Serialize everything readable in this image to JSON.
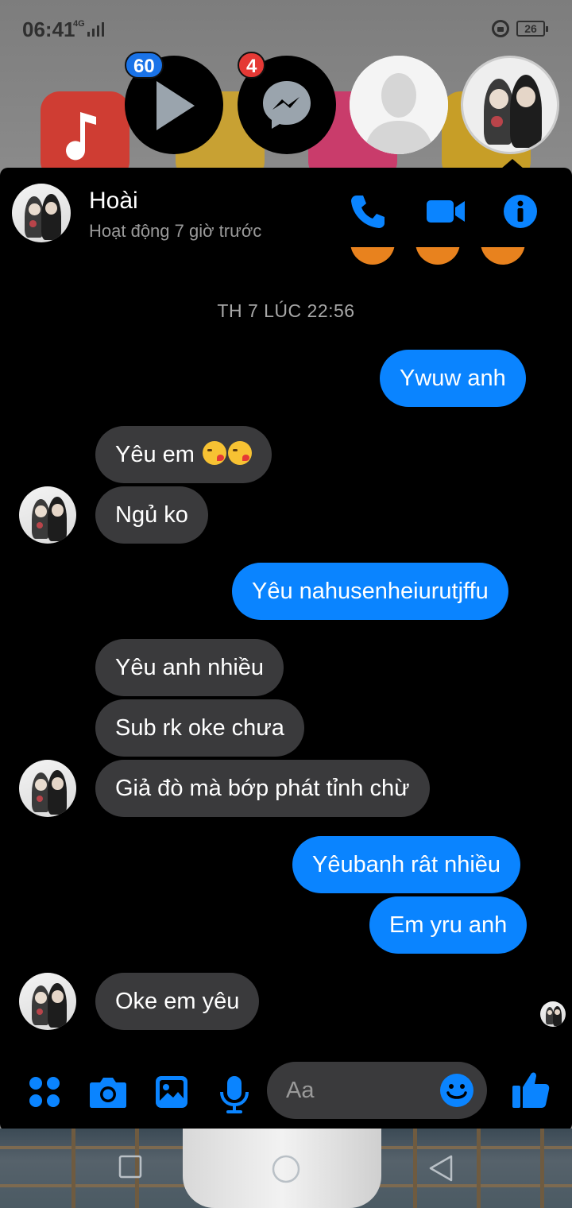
{
  "status_bar": {
    "time": "06:41",
    "network": "4G",
    "battery": "26"
  },
  "chat_heads": {
    "video_badge": "60",
    "messenger_badge": "4"
  },
  "chat": {
    "name": "Hoài",
    "status": "Hoạt động 7 giờ trước",
    "timestamp": "TH 7 LÚC 22:56",
    "messages": [
      {
        "dir": "out",
        "text": "Ywuw anh"
      },
      {
        "dir": "in",
        "text": "Yêu em"
      },
      {
        "dir": "in",
        "text": "Ngủ ko"
      },
      {
        "dir": "out",
        "text": "Yêu nahusenheiurutjffu"
      },
      {
        "dir": "in",
        "text": "Yêu anh nhiều"
      },
      {
        "dir": "in",
        "text": "Sub rk oke chưa"
      },
      {
        "dir": "in",
        "text": "Giả đò mà bớp phát tỉnh chừ"
      },
      {
        "dir": "out",
        "text": "Yêubanh rât nhiều"
      },
      {
        "dir": "out",
        "text": "Em yru anh"
      },
      {
        "dir": "in",
        "text": "Oke em yêu"
      }
    ]
  },
  "composer": {
    "placeholder": "Aa"
  },
  "colors": {
    "accent": "#0a84ff",
    "incoming_bubble": "#3a3a3c",
    "panel_bg": "#000000"
  },
  "icons": {
    "header": [
      "phone-icon",
      "video-camera-icon",
      "info-icon"
    ],
    "composer": [
      "menu-dots-icon",
      "camera-icon",
      "image-icon",
      "microphone-icon",
      "emoji-icon",
      "thumbs-up-icon"
    ],
    "nav": [
      "recents-icon",
      "home-icon",
      "back-icon"
    ]
  }
}
